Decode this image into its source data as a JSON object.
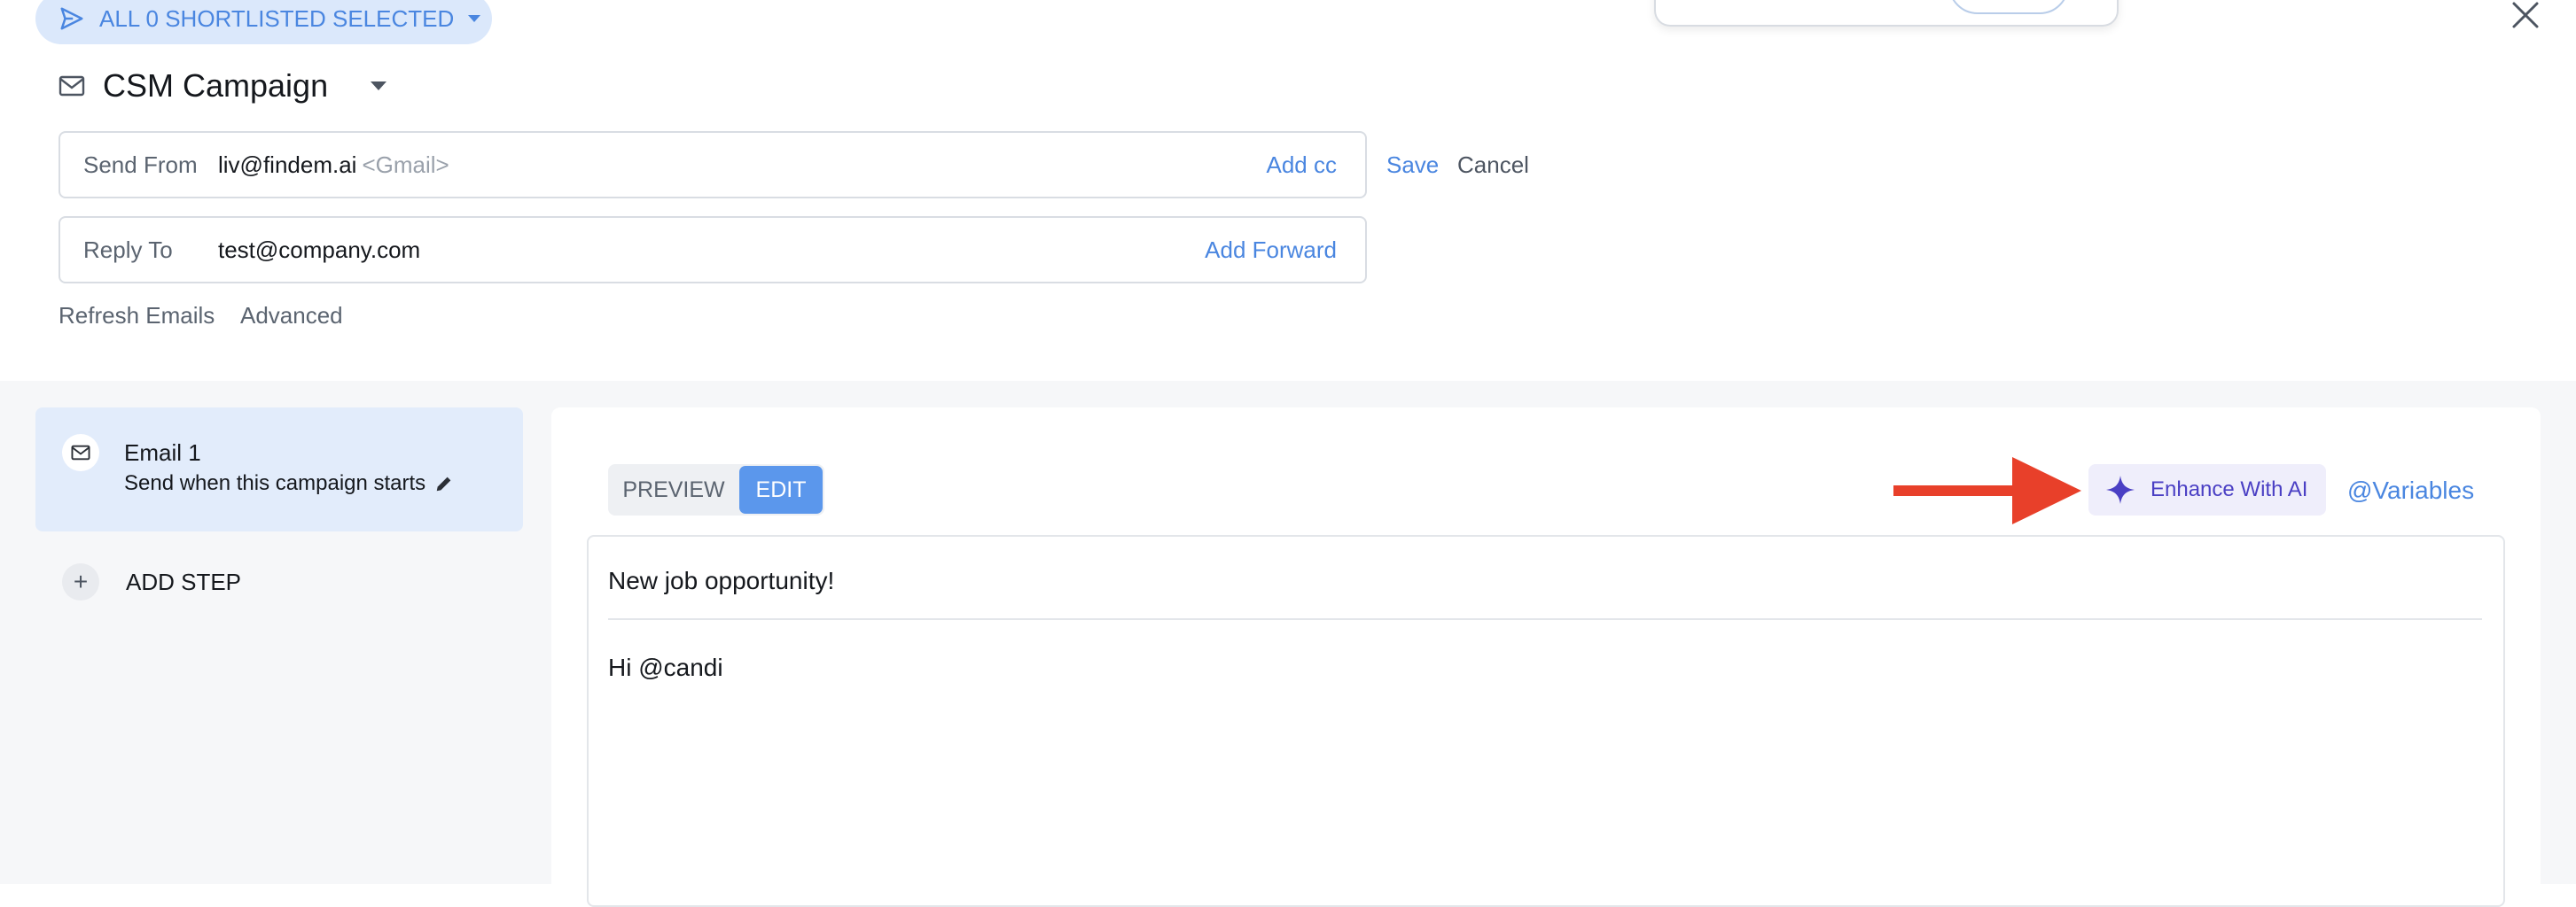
{
  "header": {
    "recipients_label": "ALL 0 SHORTLISTED SELECTED",
    "campaign_title": "CSM Campaign"
  },
  "send_from": {
    "label": "Send From",
    "email": "liv@findem.ai",
    "provider": "<Gmail>",
    "action": "Add cc"
  },
  "reply_to": {
    "label": "Reply To",
    "email": "test@company.com",
    "action": "Add Forward"
  },
  "actions": {
    "save": "Save",
    "cancel": "Cancel",
    "refresh": "Refresh Emails",
    "advanced": "Advanced"
  },
  "steps": {
    "items": [
      {
        "title": "Email 1",
        "subtitle": "Send when this campaign starts"
      }
    ],
    "add_step_label": "ADD STEP"
  },
  "editor": {
    "preview_tab": "PREVIEW",
    "edit_tab": "EDIT",
    "enhance_label": "Enhance With AI",
    "variables_label": "@Variables",
    "subject": "New job opportunity!",
    "body": "Hi @candi"
  },
  "colors": {
    "accent": "#4a86e0",
    "edit_tab_bg": "#5b97ec",
    "ai_purple": "#4a3fc4",
    "annotation_arrow": "#e8402a",
    "selected_step_bg": "#e2ecfb"
  },
  "icons": {
    "recipients": "send-icon",
    "campaign": "mail-icon",
    "close": "close-icon",
    "step": "mail-icon",
    "edit_step": "pencil-icon",
    "add_step": "plus-icon",
    "enhance": "sparkle-icon"
  }
}
